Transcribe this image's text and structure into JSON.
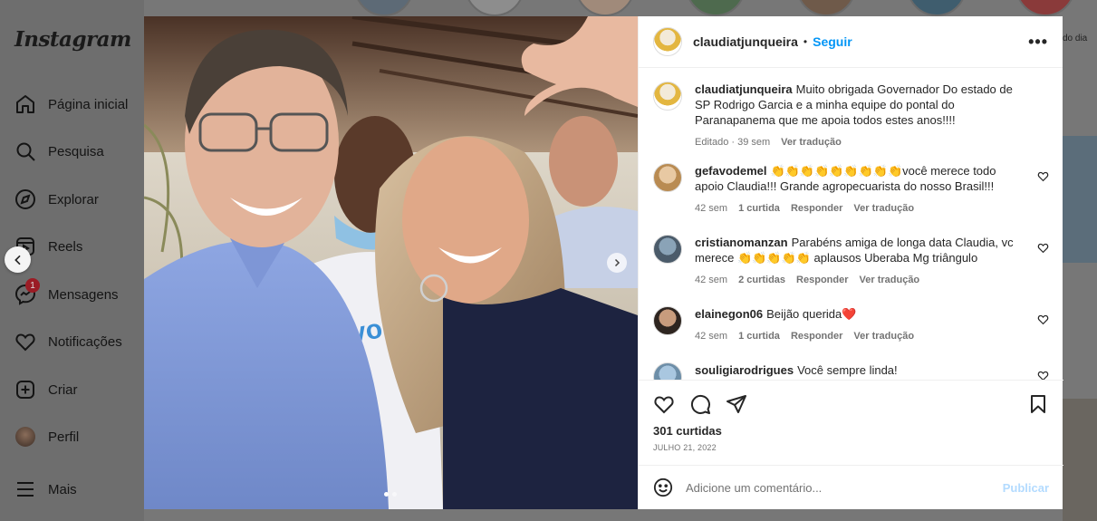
{
  "app": {
    "logo": "Instagram"
  },
  "sidebar": {
    "items": [
      {
        "label": "Página inicial",
        "icon": "home-icon"
      },
      {
        "label": "Pesquisa",
        "icon": "search-icon"
      },
      {
        "label": "Explorar",
        "icon": "compass-icon"
      },
      {
        "label": "Reels",
        "icon": "reels-icon"
      },
      {
        "label": "Mensagens",
        "icon": "messenger-icon",
        "badge": "1"
      },
      {
        "label": "Notificações",
        "icon": "heart-icon"
      },
      {
        "label": "Criar",
        "icon": "plus-square-icon"
      },
      {
        "label": "Perfil",
        "icon": "avatar"
      },
      {
        "label": "Mais",
        "icon": "menu-icon"
      }
    ]
  },
  "background": {
    "story_text": "do dia"
  },
  "post": {
    "author": "claudiatjunqueira",
    "follow_label": "Seguir",
    "more_label": "•••",
    "caption": {
      "user": "claudiatjunqueira",
      "text": "Muito obrigada Governador Do estado de SP Rodrigo Garcia e a minha equipe do pontal do Paranapanema que me apoia todos estes anos!!!!",
      "meta_time": "Editado · 39 sem",
      "translate": "Ver tradução"
    },
    "comments": [
      {
        "user": "gefavodemel",
        "text": "👏👏👏👏👏👏👏👏👏você merece todo apoio Claudia!!! Grande agropecuarista do nosso Brasil!!!",
        "time": "42 sem",
        "likes": "1 curtida",
        "reply": "Responder",
        "translate": "Ver tradução"
      },
      {
        "user": "cristianomanzan",
        "text": "Parabéns amiga de longa data Claudia, vc merece 👏👏👏👏👏 aplausos Uberaba Mg triângulo",
        "time": "42 sem",
        "likes": "2 curtidas",
        "reply": "Responder",
        "translate": "Ver tradução"
      },
      {
        "user": "elainegon06",
        "text": "Beijão querida❤️",
        "time": "42 sem",
        "likes": "1 curtida",
        "reply": "Responder",
        "translate": "Ver tradução"
      },
      {
        "user": "souligiarodrigues",
        "text": "Você sempre linda!",
        "time": "",
        "likes": "",
        "reply": "",
        "translate": ""
      }
    ],
    "likes_count": "301 curtidas",
    "date": "JULHO 21, 2022",
    "comment_placeholder": "Adicione um comentário...",
    "publish_label": "Publicar",
    "carousel": {
      "index": 1,
      "total": 2
    }
  },
  "colors": {
    "accent": "#0095f6",
    "publish_disabled": "#b3dbff",
    "badge": "#9b1c25"
  }
}
